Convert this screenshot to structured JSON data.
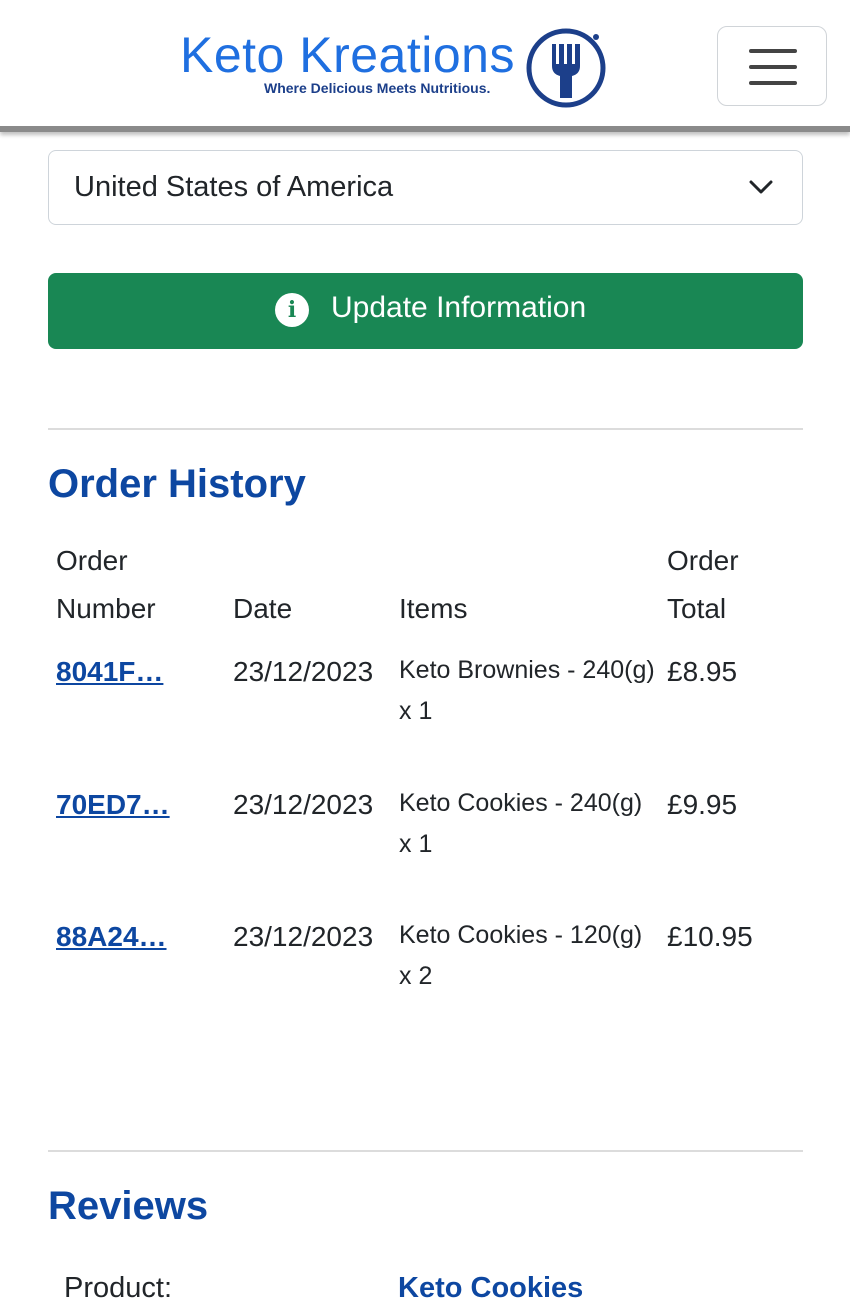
{
  "header": {
    "brand_name": "Keto Kreations",
    "brand_tagline": "Where Delicious Meets Nutritious.",
    "menu_icon": "hamburger-menu-icon",
    "brand_color": "#1f6fe0"
  },
  "account_form": {
    "country_value": "United States of America",
    "update_button_label": "Update Information",
    "update_button_color": "#198754"
  },
  "order_history": {
    "title": "Order History",
    "headers": {
      "order_number": [
        "Order",
        "Number"
      ],
      "date": "Date",
      "items": "Items",
      "order_total": [
        "Order",
        "Total"
      ]
    },
    "rows": [
      {
        "order_number": "8041F…",
        "date": "23/12/2023",
        "items": "Keto Brownies - 240(g) x 1",
        "total": "£8.95"
      },
      {
        "order_number": "70ED7…",
        "date": "23/12/2023",
        "items": "Keto Cookies - 240(g) x 1",
        "total": "£9.95"
      },
      {
        "order_number": "88A24…",
        "date": "23/12/2023",
        "items": "Keto Cookies - 120(g) x 2",
        "total": "£10.95"
      }
    ]
  },
  "reviews": {
    "title": "Reviews",
    "product_label": "Product:",
    "product_name": "Keto Cookies"
  }
}
